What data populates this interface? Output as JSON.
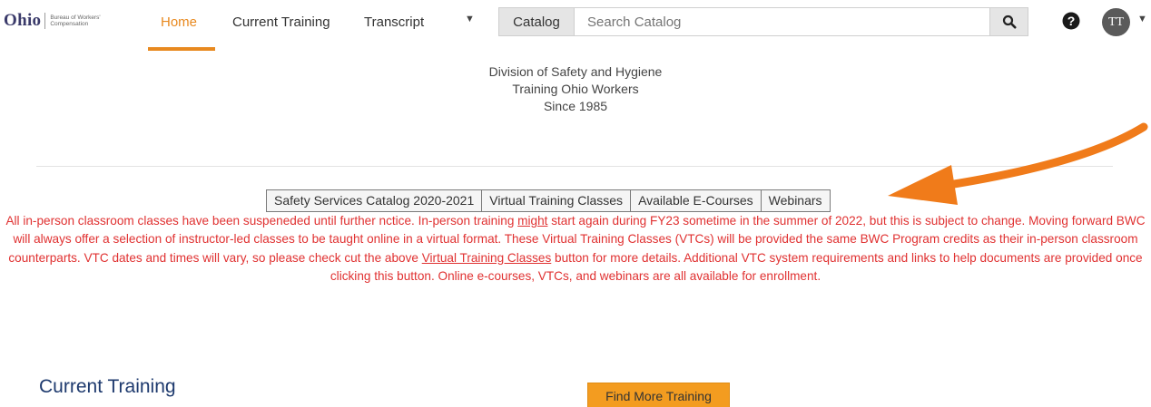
{
  "header": {
    "logo_text": "Ohio",
    "logo_subtext": "Bureau of Workers' Compensation",
    "nav": {
      "home": "Home",
      "current_training": "Current Training",
      "transcript": "Transcript"
    },
    "catalog_label": "Catalog",
    "search_placeholder": "Search Catalog",
    "avatar_initials": "TT",
    "accent_color": "#e8891f",
    "icons": [
      "dropdown-caret-icon",
      "search-icon",
      "help-icon",
      "user-avatar"
    ]
  },
  "intro": {
    "line1": "Division of Safety and Hygiene",
    "line2": "Training Ohio Workers",
    "line3": "Since 1985"
  },
  "tabs": [
    "Safety Services Catalog 2020-2021",
    "Virtual Training Classes",
    "Available E-Courses",
    "Webinars"
  ],
  "notice": {
    "color": "#e03131",
    "p1": "All in-person classroom classes have been suspeneded until further nctice. In-person training ",
    "p1_link": "might",
    "p2": " start again during FY23 sometime in the summer of 2022, but this is subject to change. Moving forward BWC will always offer a selection of instructor-led classes to be taught online in a virtual format. These Virtual Training Classes (VTCs) will be provided the same BWC Program credits as their in-person classroom counterparts. VTC dates and times will vary, so please check cut the above ",
    "p2_link": "Virtual Training Classes",
    "p3": " button for more details. Additional VTC system requirements and links to help documents are provided once clicking this button. Online e-courses, VTCs, and webinars are all available for enrollment."
  },
  "annotation": {
    "arrow_color": "#f07b1a"
  },
  "current_training": {
    "title": "Current Training",
    "find_more_label": "Find More Training"
  }
}
